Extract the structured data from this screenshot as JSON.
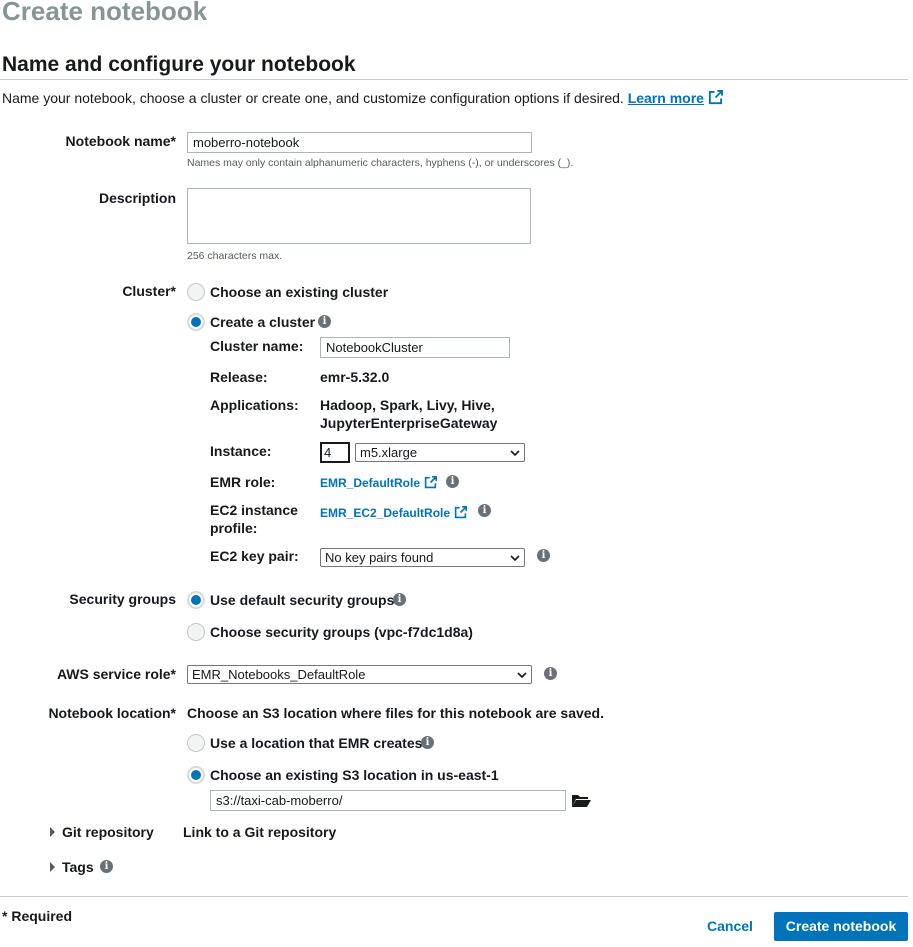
{
  "page": {
    "title": "Create notebook"
  },
  "section": {
    "title": "Name and configure your notebook",
    "intro": "Name your notebook, choose a cluster or create one, and customize configuration options if desired.",
    "learn_more": "Learn more"
  },
  "notebook_name": {
    "label": "Notebook name*",
    "value": "moberro-notebook",
    "hint": "Names may only contain alphanumeric characters, hyphens (-), or underscores (_)."
  },
  "description": {
    "label": "Description",
    "value": "",
    "hint": "256 characters max."
  },
  "cluster": {
    "label": "Cluster*",
    "option_existing": "Choose an existing cluster",
    "option_create": "Create a cluster",
    "selected": "create",
    "name_label": "Cluster name:",
    "name_value": "NotebookCluster",
    "release_label": "Release:",
    "release_value": "emr-5.32.0",
    "applications_label": "Applications:",
    "applications_line1": "Hadoop, Spark, Livy, Hive,",
    "applications_line2": "JupyterEnterpriseGateway",
    "instance_label": "Instance:",
    "instance_count": "4",
    "instance_type": "m5.xlarge",
    "emr_role_label": "EMR role:",
    "emr_role_value": "EMR_DefaultRole",
    "ec2_profile_label_line1": "EC2 instance",
    "ec2_profile_label_line2": "profile:",
    "ec2_profile_value": "EMR_EC2_DefaultRole",
    "key_pair_label": "EC2 key pair:",
    "key_pair_value": "No key pairs found"
  },
  "security_groups": {
    "label": "Security groups",
    "option_default": "Use default security groups",
    "option_choose": "Choose security groups (vpc-f7dc1d8a)",
    "selected": "default"
  },
  "service_role": {
    "label": "AWS service role*",
    "value": "EMR_Notebooks_DefaultRole"
  },
  "location": {
    "label": "Notebook location*",
    "description": "Choose an S3 location where files for this notebook are saved.",
    "option_emr": "Use a location that EMR creates",
    "option_existing": "Choose an existing S3 location in us-east-1",
    "selected": "existing",
    "path": "s3://taxi-cab-moberro/"
  },
  "git": {
    "label": "Git repository",
    "link": "Link to a Git repository"
  },
  "tags": {
    "label": "Tags"
  },
  "footer": {
    "required": "* Required",
    "cancel": "Cancel",
    "create": "Create notebook"
  },
  "colors": {
    "accent": "#0073bb",
    "title_gray": "#879596",
    "text": "#16191f",
    "icon_gray": "#687078"
  },
  "icons": {
    "external": "external-link-icon",
    "info": "info-icon",
    "folder": "folder-open-icon",
    "caret": "caret-right-icon",
    "chevron": "chevron-down-icon"
  }
}
